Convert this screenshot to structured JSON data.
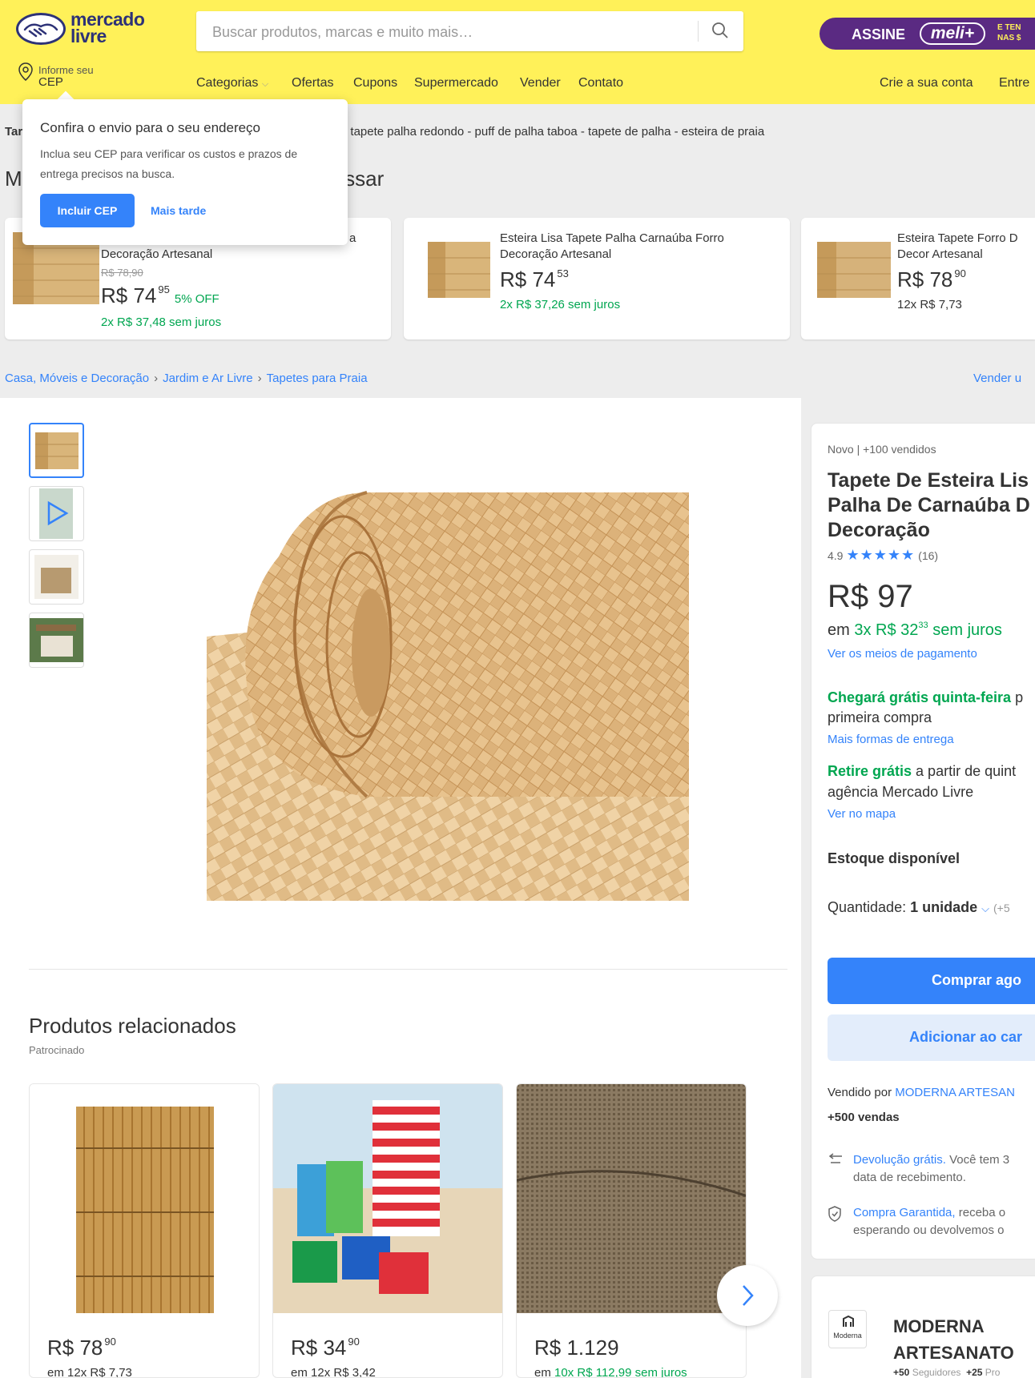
{
  "header": {
    "logo_line1": "mercado",
    "logo_line2": "livre",
    "search_placeholder": "Buscar produtos, marcas e muito mais…",
    "meli_banner": {
      "assine": "ASSINE",
      "meli": "meli+",
      "small_line1": "E TEN",
      "small_line2": "NAS $"
    },
    "cep_line1": "Informe seu",
    "cep_line2": "CEP",
    "nav": [
      "Categorias",
      "Ofertas",
      "Cupons",
      "Supermercado",
      "Vender",
      "Contato"
    ],
    "nav_right": [
      "Crie a sua conta",
      "Entre"
    ]
  },
  "related_searches": {
    "label": "Tar",
    "text": "lo - tapete palha redondo - puff de palha taboa - tapete de palha - esteira de praia"
  },
  "suggested": {
    "title_start": "M",
    "title_end": "essar",
    "cards": [
      {
        "title_l1": "a",
        "title_l2": "Decoração Artesanal",
        "old_price": "R$ 78,90",
        "price": "R$ 74",
        "cents": "95",
        "off": "5% OFF",
        "installments": "2x R$ 37,48 sem juros"
      },
      {
        "title_l1": "Esteira Lisa Tapete Palha Carnaúba Forro",
        "title_l2": "Decoração Artesanal",
        "price": "R$ 74",
        "cents": "53",
        "installments": "2x R$ 37,26 sem juros"
      },
      {
        "title_l1": "Esteira Tapete Forro D",
        "title_l2": "Decor Artesanal",
        "price": "R$ 78",
        "cents": "90",
        "installments": "12x R$ 7,73"
      }
    ]
  },
  "breadcrumb": [
    "Casa, Móveis e Decoração",
    "Jardim e Ar Livre",
    "Tapetes para Praia"
  ],
  "vender_link": "Vender u",
  "popup": {
    "title": "Confira o envio para o seu endereço",
    "body": "Inclua seu CEP para verificar os custos e prazos de entrega precisos na busca.",
    "primary": "Incluir CEP",
    "secondary": "Mais tarde"
  },
  "product": {
    "condition": "Novo  |  +100 vendidos",
    "title": "Tapete De Esteira Lis Palha De Carnaúba D Decoração",
    "rating_value": "4.9",
    "stars": "★★★★★",
    "reviews": "(16)",
    "price": "R$ 97",
    "inst_prefix": "em",
    "inst_value": "3x R$ 32",
    "inst_cents": "33",
    "inst_suffix": "sem juros",
    "payment_link": "Ver os meios de pagamento",
    "delivery_bold": "Chegará grátis quinta-feira",
    "delivery_rest": " p",
    "delivery_line2": "primeira compra",
    "delivery_link": "Mais formas de entrega",
    "pickup_bold": "Retire grátis",
    "pickup_rest": " a partir de quint",
    "pickup_line2": "agência Mercado Livre",
    "map_link": "Ver no mapa",
    "stock": "Estoque disponível",
    "qty_label": "Quantidade:",
    "qty_value": "1 unidade",
    "qty_more": "(+5",
    "buy_button": "Comprar ago",
    "cart_button": "Adicionar ao car",
    "sold_by_label": "Vendido por",
    "sold_by_name": "MODERNA ARTESAN",
    "sales": "+500 vendas",
    "return_link": "Devolução grátis.",
    "return_text": " Você tem 3",
    "return_line2": "data de recebimento.",
    "guarantee_link": "Compra Garantida,",
    "guarantee_text": " receba o",
    "guarantee_line2": "esperando ou devolvemos o"
  },
  "related": {
    "title": "Produtos relacionados",
    "subtitle": "Patrocinado",
    "items": [
      {
        "price": "R$ 78",
        "cents": "90",
        "installments": "em 12x R$ 7,73"
      },
      {
        "price": "R$ 34",
        "cents": "90",
        "installments": "em 12x R$ 3,42"
      },
      {
        "price": "R$ 1.129",
        "cents": "",
        "installments_prefix": "em",
        "installments_green": "10x R$ 112,99 sem juros"
      }
    ]
  },
  "seller": {
    "logo_text": "Moderna",
    "name_l1": "MODERNA",
    "name_l2": "ARTESANATO",
    "followers": "+50",
    "followers_label": "Seguidores",
    "products": "+25",
    "products_label": "Pro"
  },
  "colors": {
    "header": "#fff159",
    "accent": "#3483fa",
    "green": "#00a650",
    "meli": "#5a2a82"
  }
}
